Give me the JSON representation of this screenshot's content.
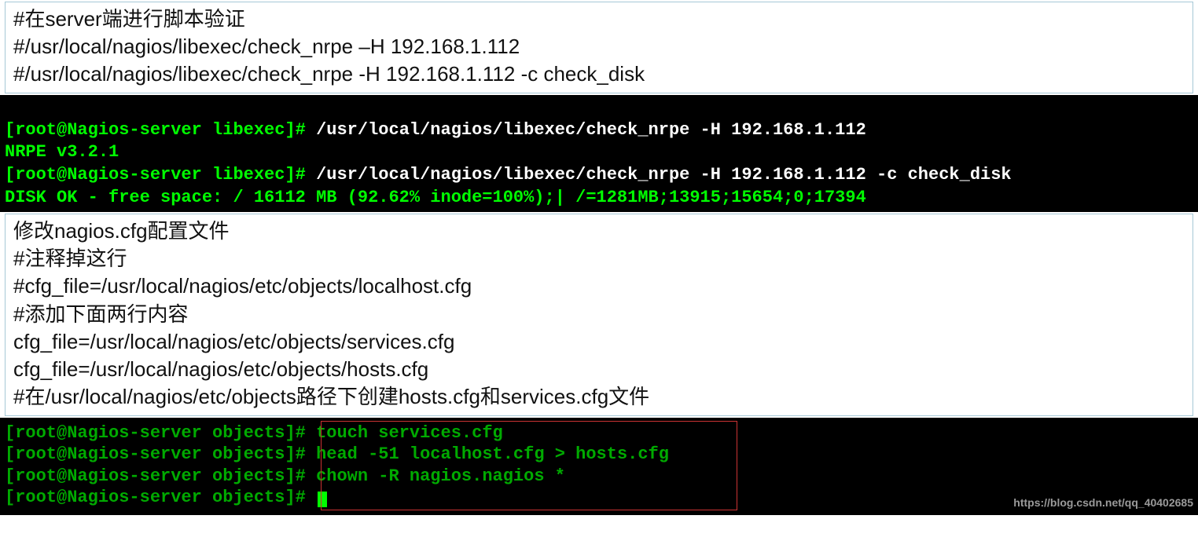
{
  "box1": {
    "lines": [
      "#在server端进行脚本验证",
      "#/usr/local/nagios/libexec/check_nrpe –H 192.168.1.112",
      "#/usr/local/nagios/libexec/check_nrpe -H 192.168.1.112 -c check_disk"
    ]
  },
  "terminal1": {
    "line1_prompt": "[root@Nagios-server libexec]# ",
    "line1_cmd": "/usr/local/nagios/libexec/check_nrpe -H 192.168.1.112",
    "line2": "NRPE v3.2.1",
    "line3_prompt": "[root@Nagios-server libexec]# ",
    "line3_cmd": "/usr/local/nagios/libexec/check_nrpe -H 192.168.1.112 -c check_disk",
    "line4": "DISK OK - free space: / 16112 MB (92.62% inode=100%);| /=1281MB;13915;15654;0;17394"
  },
  "box2": {
    "lines": [
      "修改nagios.cfg配置文件",
      "#注释掉这行",
      "#cfg_file=/usr/local/nagios/etc/objects/localhost.cfg",
      "#添加下面两行内容",
      "cfg_file=/usr/local/nagios/etc/objects/services.cfg",
      "cfg_file=/usr/local/nagios/etc/objects/hosts.cfg",
      "#在/usr/local/nagios/etc/objects路径下创建hosts.cfg和services.cfg文件"
    ]
  },
  "terminal2": {
    "partial_top": "",
    "prompt1": "[root@Nagios-server objects]# ",
    "cmd1": "touch services.cfg",
    "prompt2": "[root@Nagios-server objects]# ",
    "cmd2": "head -51 localhost.cfg > hosts.cfg",
    "prompt3": "[root@Nagios-server objects]# ",
    "cmd3": "chown -R nagios.nagios *",
    "prompt4": "[root@Nagios-server objects]# "
  },
  "watermark": "https://blog.csdn.net/qq_40402685"
}
